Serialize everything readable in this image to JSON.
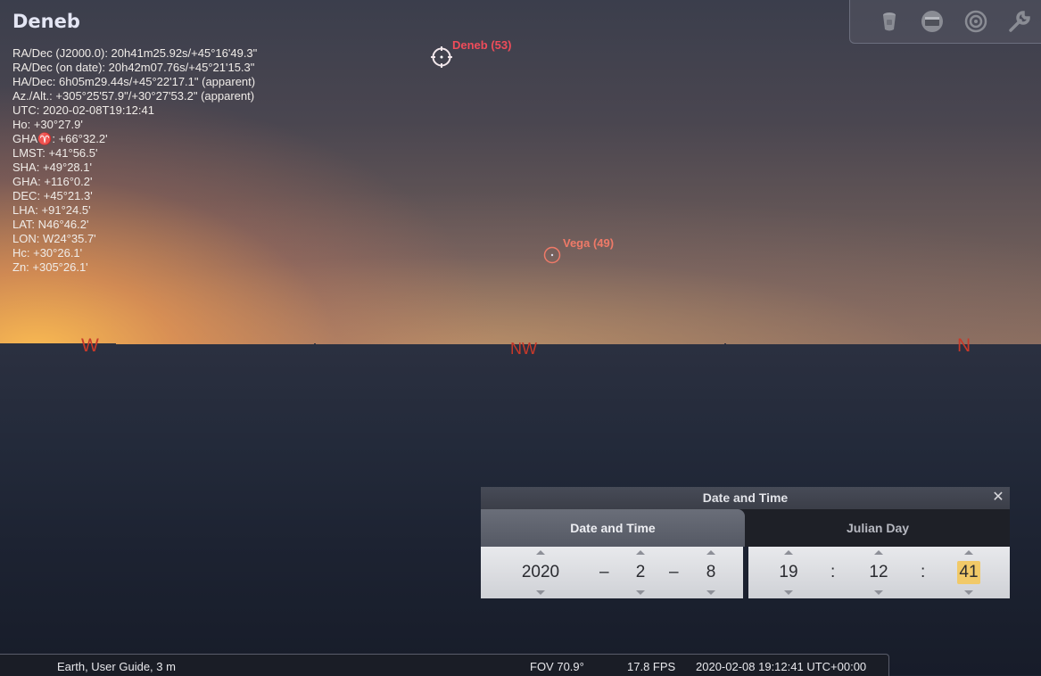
{
  "selected_object": {
    "name": "Deneb",
    "lines": [
      "RA/Dec (J2000.0): 20h41m25.92s/+45°16'49.3\"",
      "RA/Dec (on date): 20h42m07.76s/+45°21'15.3\"",
      "HA/Dec: 6h05m29.44s/+45°22'17.1\" (apparent)",
      "Az./Alt.: +305°25'57.9\"/+30°27'53.2\" (apparent)",
      "UTC: 2020-02-08T19:12:41",
      "Ho: +30°27.9'",
      "GHA♈: +66°32.2'",
      "LMST: +41°56.5'",
      "SHA: +49°28.1'",
      "GHA: +116°0.2'",
      "DEC: +45°21.3'",
      "LHA: +91°24.5'",
      "LAT: N46°46.2'",
      "LON: W24°35.7'",
      "Hc: +30°26.1'",
      "Zn: +305°26.1'"
    ]
  },
  "sky_labels": {
    "deneb": "Deneb (53)",
    "vega": "Vega (49)"
  },
  "cardinals": {
    "west": "W",
    "northwest": "NW",
    "north": "N"
  },
  "toolbar": {
    "icons": [
      "tripod-icon",
      "display-icon",
      "target-icon",
      "wrench-icon"
    ]
  },
  "date_time_window": {
    "title": "Date and Time",
    "close_symbol": "✕",
    "tabs": [
      "Date and Time",
      "Julian Day"
    ],
    "date": {
      "year": "2020",
      "month": "2",
      "day": "8",
      "separator": "–"
    },
    "time": {
      "hour": "19",
      "minute": "12",
      "second": "41",
      "separator": ":"
    }
  },
  "status_bar": {
    "location": "Earth, User Guide, 3 m",
    "fov": "FOV 70.9°",
    "fps": "17.8 FPS",
    "datetime": "2020-02-08 19:12:41 UTC+00:00"
  },
  "colors": {
    "label_red": "#ef4c5a",
    "label_vega": "#ef7a68",
    "cardinal_red": "#c8392a"
  }
}
